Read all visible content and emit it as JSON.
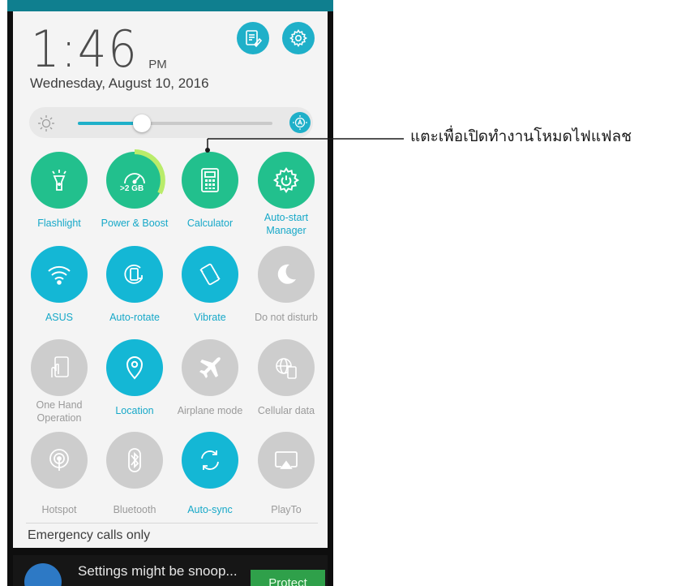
{
  "clock": {
    "time": "1:46",
    "ampm": "PM",
    "date": "Wednesday, August 10, 2016"
  },
  "header": {
    "edit_icon": "edit-notes-icon",
    "settings_icon": "gear-icon"
  },
  "brightness": {
    "level": 0.33,
    "left_icon": "sun-icon",
    "auto_icon": "auto-brightness-icon"
  },
  "tiles": [
    {
      "label": "Flashlight",
      "state": "on",
      "color": "#22c08d",
      "icon": "flashlight-icon"
    },
    {
      "label": "Power & Boost",
      "state": "on",
      "color": "#22c08d",
      "icon": "speedometer-icon",
      "badge": ">2 GB"
    },
    {
      "label": "Calculator",
      "state": "on",
      "color": "#22c08d",
      "icon": "calculator-icon"
    },
    {
      "label": "Auto-start Manager",
      "state": "on",
      "color": "#22c08d",
      "icon": "gear-power-icon"
    },
    {
      "label": "ASUS",
      "state": "on",
      "color": "#14b7d5",
      "icon": "wifi-icon"
    },
    {
      "label": "Auto-rotate",
      "state": "on",
      "color": "#14b7d5",
      "icon": "auto-rotate-icon"
    },
    {
      "label": "Vibrate",
      "state": "on",
      "color": "#14b7d5",
      "icon": "vibrate-icon"
    },
    {
      "label": "Do not disturb",
      "state": "off",
      "color": "#cdcdcd",
      "icon": "moon-icon"
    },
    {
      "label": "One Hand Operation",
      "state": "off",
      "color": "#cdcdcd",
      "icon": "one-hand-icon"
    },
    {
      "label": "Location",
      "state": "on",
      "color": "#14b7d5",
      "icon": "location-pin-icon"
    },
    {
      "label": "Airplane mode",
      "state": "off",
      "color": "#cdcdcd",
      "icon": "airplane-icon"
    },
    {
      "label": "Cellular data",
      "state": "off",
      "color": "#cdcdcd",
      "icon": "cellular-data-icon"
    },
    {
      "label": "Hotspot",
      "state": "off",
      "color": "#cdcdcd",
      "icon": "hotspot-icon"
    },
    {
      "label": "Bluetooth",
      "state": "off",
      "color": "#cdcdcd",
      "icon": "bluetooth-icon"
    },
    {
      "label": "Auto-sync",
      "state": "on",
      "color": "#14b7d5",
      "icon": "sync-icon"
    },
    {
      "label": "PlayTo",
      "state": "off",
      "color": "#cdcdcd",
      "icon": "cast-icon"
    }
  ],
  "status": {
    "emergency": "Emergency calls only"
  },
  "notification": {
    "text": "Settings might be snoop...",
    "button": "Protect",
    "icon": "shield-icon"
  },
  "callout": {
    "text": "แตะเพื่อเปิดทำงานโหมดไฟแฟลช"
  },
  "colors": {
    "accent": "#1fb0c9",
    "green": "#22c08d",
    "cyan": "#14b7d5",
    "disabled": "#cdcdcd",
    "panel_bg": "#f4f4f4"
  }
}
